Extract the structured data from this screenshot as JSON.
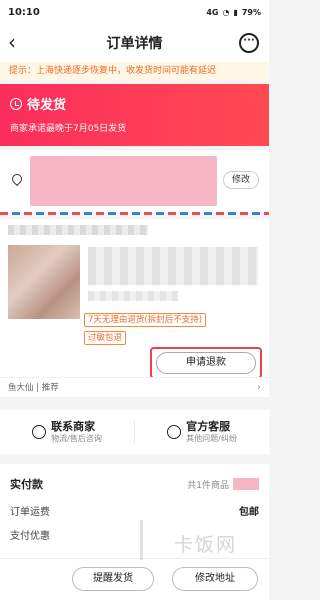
{
  "status_bar": {
    "time": "10:10",
    "network": "4G",
    "battery": "79%"
  },
  "nav": {
    "title": "订单详情",
    "more": "···"
  },
  "notice": "提示：上海快递逐步恢复中，收发货时间可能有延迟",
  "order_status": {
    "title": "待发货",
    "subtitle": "商家承诺最晚于7月05日发货"
  },
  "address": {
    "edit_label": "修改"
  },
  "product": {
    "tags": [
      "7天无理由退货(拆封后不支持)",
      "过敏包退"
    ],
    "refund_label": "申请退款"
  },
  "recommend": {
    "label": "鱼大仙 | 推荐",
    "arrow": "›"
  },
  "contact": {
    "merchant_title": "联系商家",
    "merchant_sub": "物流/售后咨询",
    "service_title": "官方客服",
    "service_sub": "其他问题/纠纷"
  },
  "payment": {
    "title": "实付款",
    "count": "共1件商品",
    "shipping_label": "订单运费",
    "shipping_value": "包邮",
    "discount_label": "支付优惠"
  },
  "bottom": {
    "remind_label": "提醒发货",
    "modify_label": "修改地址"
  },
  "watermark": "卡饭网",
  "colors": {
    "accent": "#fb2d5c",
    "notice_text": "#f06a26",
    "highlight_border": "#e8434a"
  }
}
